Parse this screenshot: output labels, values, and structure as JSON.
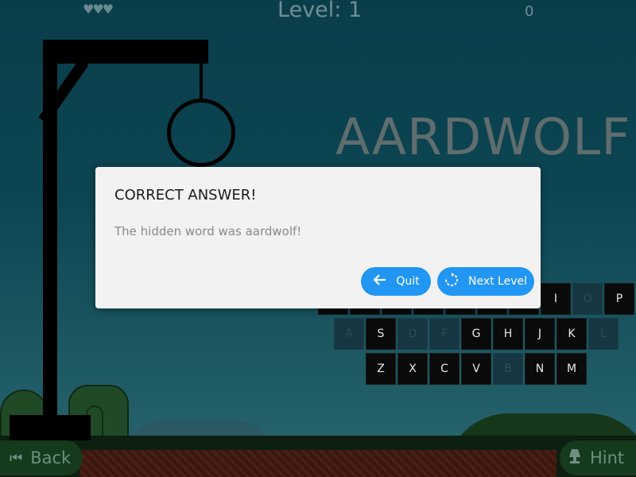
{
  "hud": {
    "lives_icons": "♥♥♥",
    "level_text": "Level: 1",
    "score": "0"
  },
  "hidden_word_display": "AARDWOLF",
  "keyboard": {
    "row1": [
      {
        "label": "",
        "used": false
      },
      {
        "label": "",
        "used": false
      },
      {
        "label": "",
        "used": false
      },
      {
        "label": "",
        "used": false
      },
      {
        "label": "",
        "used": false
      },
      {
        "label": "",
        "used": false
      },
      {
        "label": "",
        "used": false
      },
      {
        "label": "I",
        "used": false
      },
      {
        "label": "O",
        "used": true
      },
      {
        "label": "P",
        "used": false
      }
    ],
    "row2": [
      {
        "label": "A",
        "used": true
      },
      {
        "label": "S",
        "used": false
      },
      {
        "label": "D",
        "used": true
      },
      {
        "label": "F",
        "used": true
      },
      {
        "label": "G",
        "used": false
      },
      {
        "label": "H",
        "used": false
      },
      {
        "label": "J",
        "used": false
      },
      {
        "label": "K",
        "used": false
      },
      {
        "label": "L",
        "used": true
      }
    ],
    "row3": [
      {
        "label": "Z",
        "used": false
      },
      {
        "label": "X",
        "used": false
      },
      {
        "label": "C",
        "used": false
      },
      {
        "label": "V",
        "used": false
      },
      {
        "label": "B",
        "used": true
      },
      {
        "label": "N",
        "used": false
      },
      {
        "label": "M",
        "used": false
      }
    ]
  },
  "bottom": {
    "back_label": "Back",
    "hint_label": "Hint"
  },
  "dialog": {
    "title": "CORRECT ANSWER!",
    "message": "The hidden word was aardwolf!",
    "quit_label": "Quit",
    "next_label": "Next Level"
  },
  "colors": {
    "accent": "#2196f3",
    "dialog_bg": "#f2f2f2"
  }
}
